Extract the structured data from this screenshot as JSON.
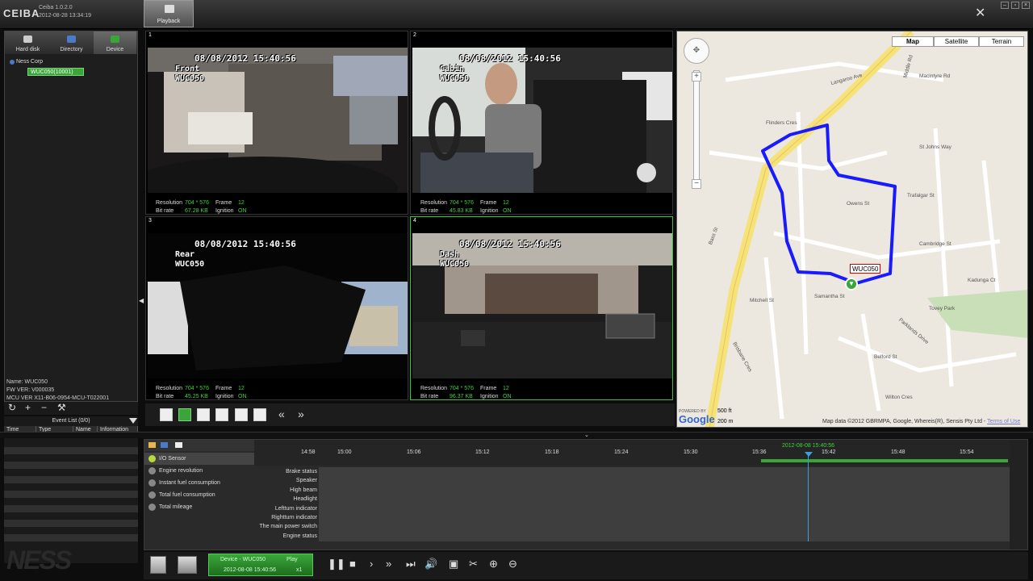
{
  "app": {
    "logo": "CEIBA",
    "version": "Ceiba 1.0.2.0",
    "datetime": "2012-08-28 13:34:19",
    "tab_playback": "Playback"
  },
  "left_tabs": [
    {
      "label": "Hard disk",
      "icon": "hard-disk-icon"
    },
    {
      "label": "Directory",
      "icon": "directory-icon"
    },
    {
      "label": "Device",
      "icon": "device-icon"
    }
  ],
  "tree": {
    "root": "Ness Corp",
    "device": "WUC050(10001)"
  },
  "device_info": {
    "name": "Name: WUC050",
    "fw": "FW VER: V000035",
    "mcu": "MCU VER X11-B06-0954-MCU-T022001"
  },
  "event_list": {
    "title": "Event List (0/0)",
    "columns": [
      "Time",
      "Type",
      "Name",
      "Information"
    ]
  },
  "cameras": [
    {
      "num": "1",
      "timestamp": "08/08/2012 15:40:56",
      "name": "Front",
      "id": "WUC050",
      "resolution": "704 * 576",
      "frame": "12",
      "bitrate": "67.28 KB",
      "ignition": "ON"
    },
    {
      "num": "2",
      "timestamp": "08/08/2012 15:40:56",
      "name": "Cabin",
      "id": "WUC050",
      "resolution": "704 * 576",
      "frame": "12",
      "bitrate": "45.83 KB",
      "ignition": "ON"
    },
    {
      "num": "3",
      "timestamp": "08/08/2012 15:40:56",
      "name": "Rear",
      "id": "WUC050",
      "resolution": "704 * 576",
      "frame": "12",
      "bitrate": "45.25 KB",
      "ignition": "ON"
    },
    {
      "num": "4",
      "timestamp": "08/08/2012 15:40:56",
      "name": "Dash",
      "id": "WUC050",
      "resolution": "704 * 576",
      "frame": "12",
      "bitrate": "96.37 KB",
      "ignition": "ON"
    }
  ],
  "caminfo_labels": {
    "resolution": "Resolution",
    "frame": "Frame",
    "bitrate": "Bit rate",
    "ignition": "Ignition"
  },
  "map": {
    "types": [
      "Map",
      "Satellite",
      "Terrain"
    ],
    "active_type": "Map",
    "vehicle_label": "WUC050",
    "attribution": "Map data ©2012 GBRMPA, Google, Whereis(R), Sensis Pty Ltd -",
    "terms": "Terms of Use",
    "powered_by": "POWERED BY",
    "brand": "Google",
    "scale_ft": "500 ft",
    "scale_m": "200 m",
    "streets": [
      "Middle Rd",
      "Langaroo Ave",
      "Macintyre Rd",
      "St Johns Way",
      "Trafalgar St",
      "Owens St",
      "Cambridge St",
      "Kadunga Ct",
      "Samantha St",
      "Tovey Park",
      "Bass St",
      "Flinders Cres",
      "Mitchell St",
      "Belford St",
      "Wilton Cres",
      "Parklands Drive",
      "Brisbane Cres"
    ]
  },
  "timeline": {
    "sensors": [
      {
        "label": "I/O Sensor",
        "active": true
      },
      {
        "label": "Engine revolution",
        "active": false
      },
      {
        "label": "Instant fuel consumption",
        "active": false
      },
      {
        "label": "Total fuel consumption",
        "active": false
      },
      {
        "label": "Total mileage",
        "active": false
      }
    ],
    "ticks": [
      "14:58",
      "15:00",
      "15:06",
      "15:12",
      "15:18",
      "15:24",
      "15:30",
      "15:36",
      "15:42",
      "15:48",
      "15:54"
    ],
    "current_time": "2012-08-08 15:40:56",
    "channels": [
      "Brake status",
      "Speaker",
      "High beam",
      "Headlight",
      "Leftturn indicator",
      "Rightturn indicator",
      "The main power switch",
      "Engine status"
    ]
  },
  "playback": {
    "device_label": "Device - WUC050",
    "mode": "Play",
    "datetime": "2012-08-08 15:40:56",
    "speed": "x1"
  },
  "colors": {
    "accent_green": "#3aa63a",
    "route_blue": "#1a1aff",
    "cursor_blue": "#3aa0e0"
  }
}
